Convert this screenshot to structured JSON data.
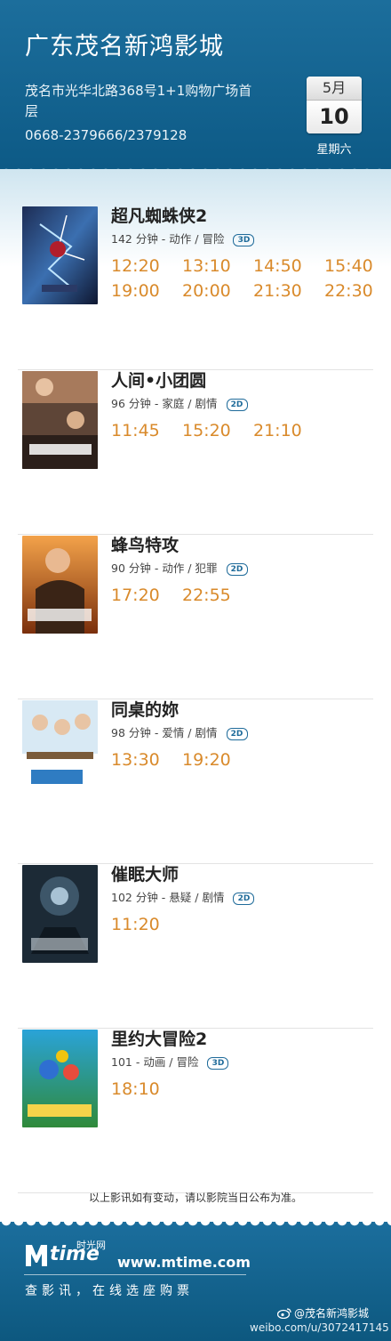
{
  "header": {
    "cinema_name": "广东茂名新鸿影城",
    "address": "茂名市光华北路368号1+1购物广场首层",
    "phone": "0668-2379666/2379128",
    "date_month": "5月",
    "date_day": "10",
    "weekday": "星期六"
  },
  "colors": {
    "header_blue": "#17689a",
    "showtime_orange": "#d98a2b",
    "badge_blue": "#1f6b9a"
  },
  "movies": [
    {
      "title": "超凡蜘蛛侠2",
      "info": "142 分钟 - 动作 / 冒险",
      "format": "3D",
      "times": [
        "12:20",
        "13:10",
        "14:50",
        "15:40",
        "19:00",
        "20:00",
        "21:30",
        "22:30"
      ]
    },
    {
      "title": "人间•小团圆",
      "info": "96 分钟 - 家庭 / 剧情",
      "format": "2D",
      "times": [
        "11:45",
        "15:20",
        "21:10"
      ]
    },
    {
      "title": "蜂鸟特攻",
      "info": "90 分钟 - 动作 / 犯罪",
      "format": "2D",
      "times": [
        "17:20",
        "22:55"
      ]
    },
    {
      "title": "同桌的妳",
      "info": "98 分钟 - 爱情 / 剧情",
      "format": "2D",
      "times": [
        "13:30",
        "19:20"
      ]
    },
    {
      "title": "催眠大师",
      "info": "102 分钟 - 悬疑 / 剧情",
      "format": "2D",
      "times": [
        "11:20"
      ]
    },
    {
      "title": "里约大冒险2",
      "info": "101 - 动画 / 冒险",
      "format": "3D",
      "times": [
        "18:10"
      ]
    }
  ],
  "notice": "以上影讯如有变动，请以影院当日公布为准。",
  "footer": {
    "logo_text": "time",
    "logo_cn": "时光网",
    "site_url": "www.mtime.com",
    "slogan": "查影讯，在线选座购票",
    "weibo_name": "@茂名新鸿影城",
    "weibo_url": "weibo.com/u/3072417145"
  }
}
